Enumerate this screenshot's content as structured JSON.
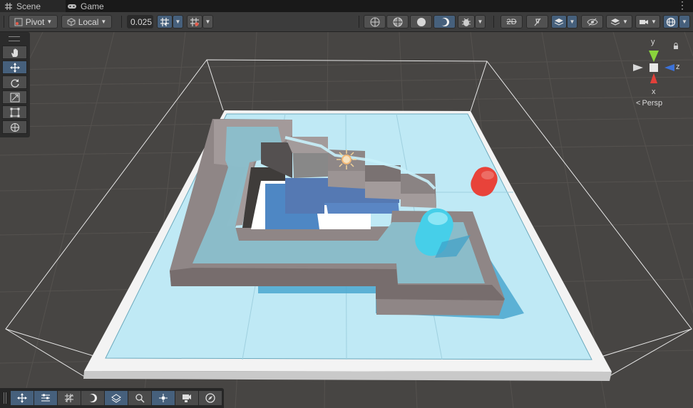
{
  "tabs": [
    {
      "label": "Scene",
      "icon": "grid-icon",
      "active": true
    },
    {
      "label": "Game",
      "icon": "gamepad-icon",
      "active": false
    }
  ],
  "toolbar": {
    "pivot_label": "Pivot",
    "local_label": "Local",
    "snap_value": "0.025"
  },
  "gizmo": {
    "axis_y": "y",
    "axis_z": "z",
    "axis_x": "x",
    "projection_label": "Persp"
  },
  "colors": {
    "accent": "#46607c",
    "panel": "#3c3c3c",
    "tabbar": "#191919",
    "ground_grid": "#474543",
    "water": "#b8e6f2",
    "wall": "#8a7e7e",
    "capsule_red": "#e8433a",
    "capsule_cyan": "#4fd3ec"
  },
  "tools": [
    "hand-tool-icon",
    "move-tool-icon",
    "rotate-tool-icon",
    "scale-tool-icon",
    "rect-tool-icon",
    "transform-tool-icon"
  ],
  "overlay_tools": [
    "move-overlay-icon",
    "align-overlay-icon",
    "grid-overlay-icon",
    "lighting-overlay-icon",
    "navmesh-overlay-icon",
    "search-overlay-icon",
    "pivot-overlay-icon",
    "camera-overlay-icon",
    "compass-overlay-icon"
  ]
}
